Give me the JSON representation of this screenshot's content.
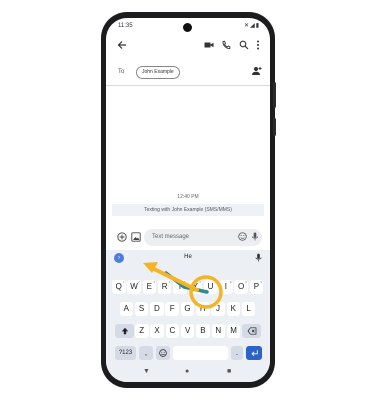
{
  "status_bar": {
    "time": "11:35",
    "icons": "✕◢▮"
  },
  "appbar": {
    "back_icon": "arrow-left-icon",
    "video_icon": "video-call-icon",
    "phone_icon": "phone-icon",
    "search_icon": "search-icon",
    "more_icon": "more-vertical-icon"
  },
  "recipient": {
    "to_label": "To",
    "chip": "John Example"
  },
  "conversation": {
    "timestamp": "12:40 PM",
    "sms_banner": "Texting with John Example (SMS/MMS)"
  },
  "compose": {
    "placeholder": "Text message"
  },
  "keyboard": {
    "suggestion": "He",
    "row1": [
      "Q",
      "W",
      "E",
      "R",
      "T",
      "Y",
      "U",
      "I",
      "O",
      "P"
    ],
    "row1_alt": [
      "1",
      "2",
      "3",
      "4",
      "5",
      "6",
      "7",
      "8",
      "9",
      "0"
    ],
    "row2": [
      "A",
      "S",
      "D",
      "F",
      "G",
      "H",
      "J",
      "K",
      "L"
    ],
    "row3": [
      "Z",
      "X",
      "C",
      "V",
      "B",
      "N",
      "M"
    ],
    "symbols_label": "?123",
    "comma": ",",
    "period": ".",
    "emoji_icon": "emoji-icon"
  },
  "gesture": {
    "highlight_key": "H",
    "swipe_to_key": "E",
    "accent_color": "#f4b425",
    "trail_color": "#2f8a8a"
  },
  "colors": {
    "accent": "#2d62c9",
    "keyboard_bg": "#eceff4"
  }
}
